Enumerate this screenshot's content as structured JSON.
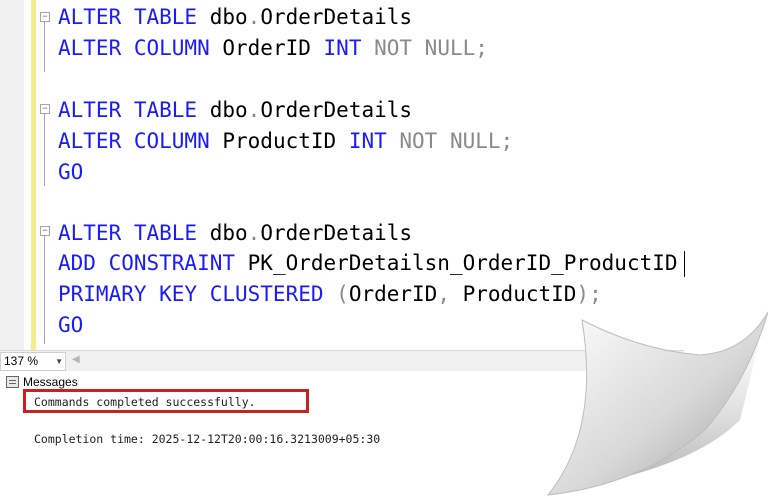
{
  "editor": {
    "lines": [
      {
        "parts": [
          {
            "t": "ALTER TABLE ",
            "c": "kw"
          },
          {
            "t": "dbo",
            "c": ""
          },
          {
            "t": ".",
            "c": "gray"
          },
          {
            "t": "OrderDetails",
            "c": ""
          }
        ]
      },
      {
        "parts": [
          {
            "t": "ALTER COLUMN ",
            "c": "kw"
          },
          {
            "t": "OrderID ",
            "c": ""
          },
          {
            "t": "INT ",
            "c": "kw"
          },
          {
            "t": "NOT NULL",
            "c": "gray"
          },
          {
            "t": ";",
            "c": "gray"
          }
        ]
      },
      {
        "parts": []
      },
      {
        "parts": [
          {
            "t": "ALTER TABLE ",
            "c": "kw"
          },
          {
            "t": "dbo",
            "c": ""
          },
          {
            "t": ".",
            "c": "gray"
          },
          {
            "t": "OrderDetails",
            "c": ""
          }
        ]
      },
      {
        "parts": [
          {
            "t": "ALTER COLUMN ",
            "c": "kw"
          },
          {
            "t": "ProductID ",
            "c": ""
          },
          {
            "t": "INT ",
            "c": "kw"
          },
          {
            "t": "NOT NULL",
            "c": "gray"
          },
          {
            "t": ";",
            "c": "gray"
          }
        ]
      },
      {
        "parts": [
          {
            "t": "GO",
            "c": "kw"
          }
        ]
      },
      {
        "parts": []
      },
      {
        "parts": [
          {
            "t": "ALTER TABLE ",
            "c": "kw"
          },
          {
            "t": "dbo",
            "c": ""
          },
          {
            "t": ".",
            "c": "gray"
          },
          {
            "t": "OrderDetails",
            "c": ""
          }
        ]
      },
      {
        "parts": [
          {
            "t": "ADD CONSTRAINT ",
            "c": "kw"
          },
          {
            "t": "PK_OrderDetailsn_OrderID_ProductID",
            "c": ""
          }
        ],
        "caret": true
      },
      {
        "parts": [
          {
            "t": "PRIMARY KEY CLUSTERED ",
            "c": "kw"
          },
          {
            "t": "(",
            "c": "gray"
          },
          {
            "t": "OrderID",
            "c": ""
          },
          {
            "t": ", ",
            "c": "gray"
          },
          {
            "t": "ProductID",
            "c": ""
          },
          {
            "t": ");",
            "c": "gray"
          }
        ]
      },
      {
        "parts": [
          {
            "t": "GO",
            "c": "kw"
          }
        ]
      }
    ]
  },
  "zoom": {
    "value": "137 %"
  },
  "messages": {
    "tab_label": "Messages",
    "status": "Commands completed successfully.",
    "completion": "Completion time: 2025-12-12T20:00:16.3213009+05:30"
  },
  "colors": {
    "keyword": "#1a1aff",
    "punctuation": "#8a8a8a",
    "highlight": "#cc1f1f"
  }
}
